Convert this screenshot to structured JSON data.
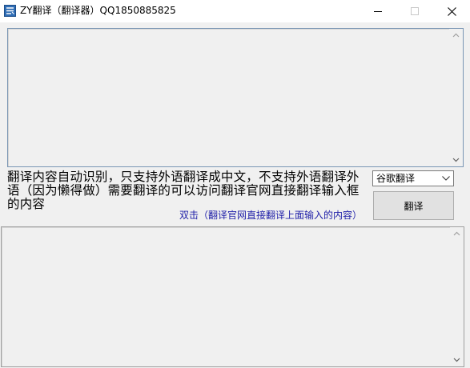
{
  "window": {
    "title": "ZY翻译（翻译器）QQ1850885825",
    "app_icon": "translate-app-icon",
    "controls": {
      "minimize": "minimize-icon",
      "maximize": "maximize-icon",
      "close": "close-icon"
    }
  },
  "input_box": {
    "value": ""
  },
  "notice": "翻译内容自动识别，只支持外语翻译成中文，不支持外语翻译外语（因为懒得做）需要翻译的可以访问翻译官网直接翻译输入框的内容",
  "hint": "双击（翻译官网直接翻译上面输入的内容）",
  "engine_select": {
    "selected": "谷歌翻译",
    "arrow_icon": "chevron-down-icon"
  },
  "translate_button": {
    "label": "翻译"
  },
  "output_box": {
    "value": ""
  },
  "colors": {
    "hint_text": "#1f1fa8",
    "window_bg": "#f0f0f0",
    "input_border": "#7a96b4"
  }
}
